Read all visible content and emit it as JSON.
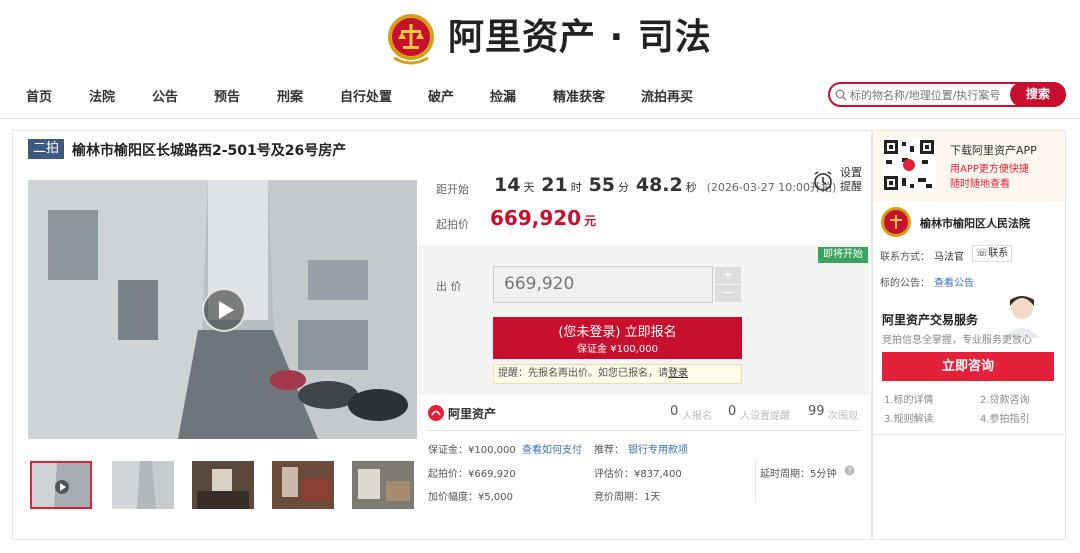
{
  "header": {
    "brand": "阿里资产 · 司法"
  },
  "nav": [
    "首页",
    "法院",
    "公告",
    "预告",
    "刑案",
    "自行处置",
    "破产",
    "捡漏",
    "精准获客",
    "流拍再买"
  ],
  "search": {
    "placeholder": "标的物名称/地理位置/执行案号",
    "button": "搜索"
  },
  "item": {
    "badge": "二拍",
    "title": "榆林市榆阳区长城路西2-501号及26号房产",
    "countdown_label": "距开始",
    "days": "14",
    "days_unit": "天",
    "hours": "21",
    "hours_unit": "时",
    "minutes": "55",
    "minutes_unit": "分",
    "seconds": "48.2",
    "seconds_unit": "秒",
    "start_time": "(2026-03-27 10:00开拍)",
    "remind_line1": "设置",
    "remind_line2": "提醒",
    "start_price_label": "起拍价",
    "start_price": "669,920",
    "start_price_unit": "元",
    "soon_tag": "即将开始",
    "bid_label": "出 价",
    "bid_value": "669,920",
    "plus": "+",
    "minus": "−",
    "signup_line1": "(您未登录) 立即报名",
    "signup_line2": "保证金 ¥100,000",
    "tip_text": "提醒：先报名再出价。如您已报名，请",
    "tip_link": "登录"
  },
  "stats": {
    "brand": "阿里资产",
    "signups": "0",
    "signups_label": "人报名",
    "reminders": "0",
    "reminders_label": "人设置提醒",
    "views": "99",
    "views_label": "次围观"
  },
  "details": {
    "deposit": "保证金：¥100,000",
    "how_to_pay": "查看如何支付",
    "recommend": "推荐：",
    "bank_loan": "银行专用款项",
    "start_price": "起拍价：¥669,920",
    "appraisal": "评估价：¥837,400",
    "delay": "延时周期：5分钟",
    "increment": "加价幅度：¥5,000",
    "period": "竞价周期：1天"
  },
  "sidebar": {
    "app_title": "下载阿里资产APP",
    "app_desc1": "用APP更方便快捷",
    "app_desc2": "随时随地查看",
    "court_name": "榆林市榆阳区人民法院",
    "contact_label": "联系方式：",
    "contact_name": "马法官",
    "contact_btn": "联系",
    "notice_label": "标的公告：",
    "notice_link": "查看公告",
    "service_title": "阿里资产交易服务",
    "service_desc": "竞拍信息全掌握，专业服务更放心",
    "consult_btn": "立即咨询",
    "guides": [
      "1.标的详情",
      "2.贷款咨询",
      "3.规则解读",
      "4.参拍指引"
    ]
  },
  "colors": {
    "brand_red": "#c8102e",
    "badge_blue": "#3d5a80",
    "soon_green": "#3aa35c"
  }
}
